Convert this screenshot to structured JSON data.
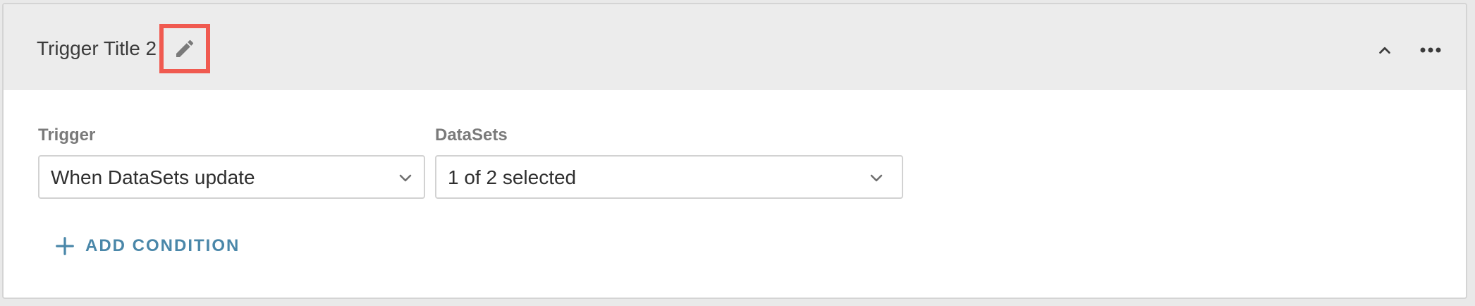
{
  "header": {
    "title": "Trigger Title 2",
    "edit_icon": "pencil-icon",
    "collapse_icon": "chevron-up-icon",
    "more_icon": "more-horizontal-icon"
  },
  "trigger": {
    "label": "Trigger",
    "value": "When DataSets update"
  },
  "datasets": {
    "label": "DataSets",
    "value": "1 of 2 selected"
  },
  "add_condition": {
    "label": "ADD CONDITION",
    "icon": "plus-icon"
  },
  "colors": {
    "accent": "#4a87a9",
    "highlight": "#f05a50",
    "header_bg": "#ececec"
  }
}
